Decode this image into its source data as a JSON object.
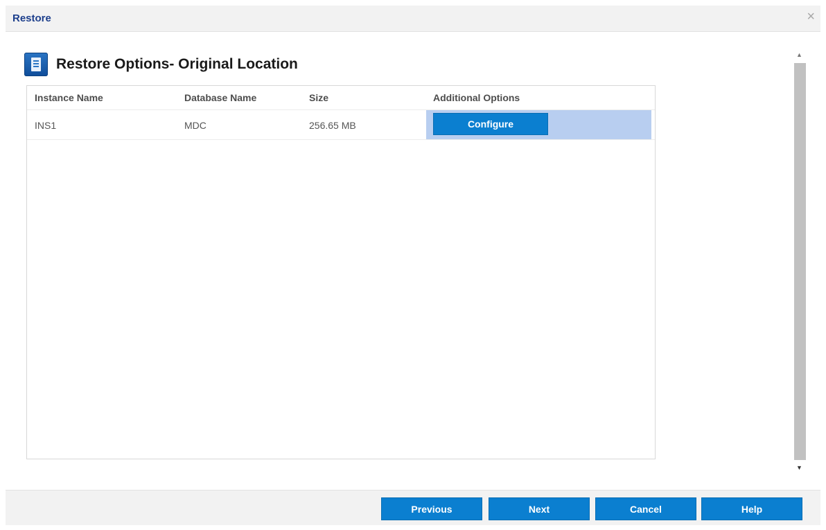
{
  "dialog": {
    "title": "Restore",
    "close_glyph": "×"
  },
  "header": {
    "icon": "database-icon",
    "title": "Restore Options- Original Location"
  },
  "table": {
    "columns": [
      "Instance Name",
      "Database Name",
      "Size",
      "Additional Options"
    ],
    "rows": [
      {
        "instance": "INS1",
        "database": "MDC",
        "size": "256.65 MB",
        "action_label": "Configure"
      }
    ]
  },
  "footer": {
    "previous_label": "Previous",
    "next_label": "Next",
    "cancel_label": "Cancel",
    "help_label": "Help"
  },
  "colors": {
    "accent": "#0b7fd0",
    "title_text": "#1d3f8c",
    "selected_cell": "#b8cef0"
  }
}
